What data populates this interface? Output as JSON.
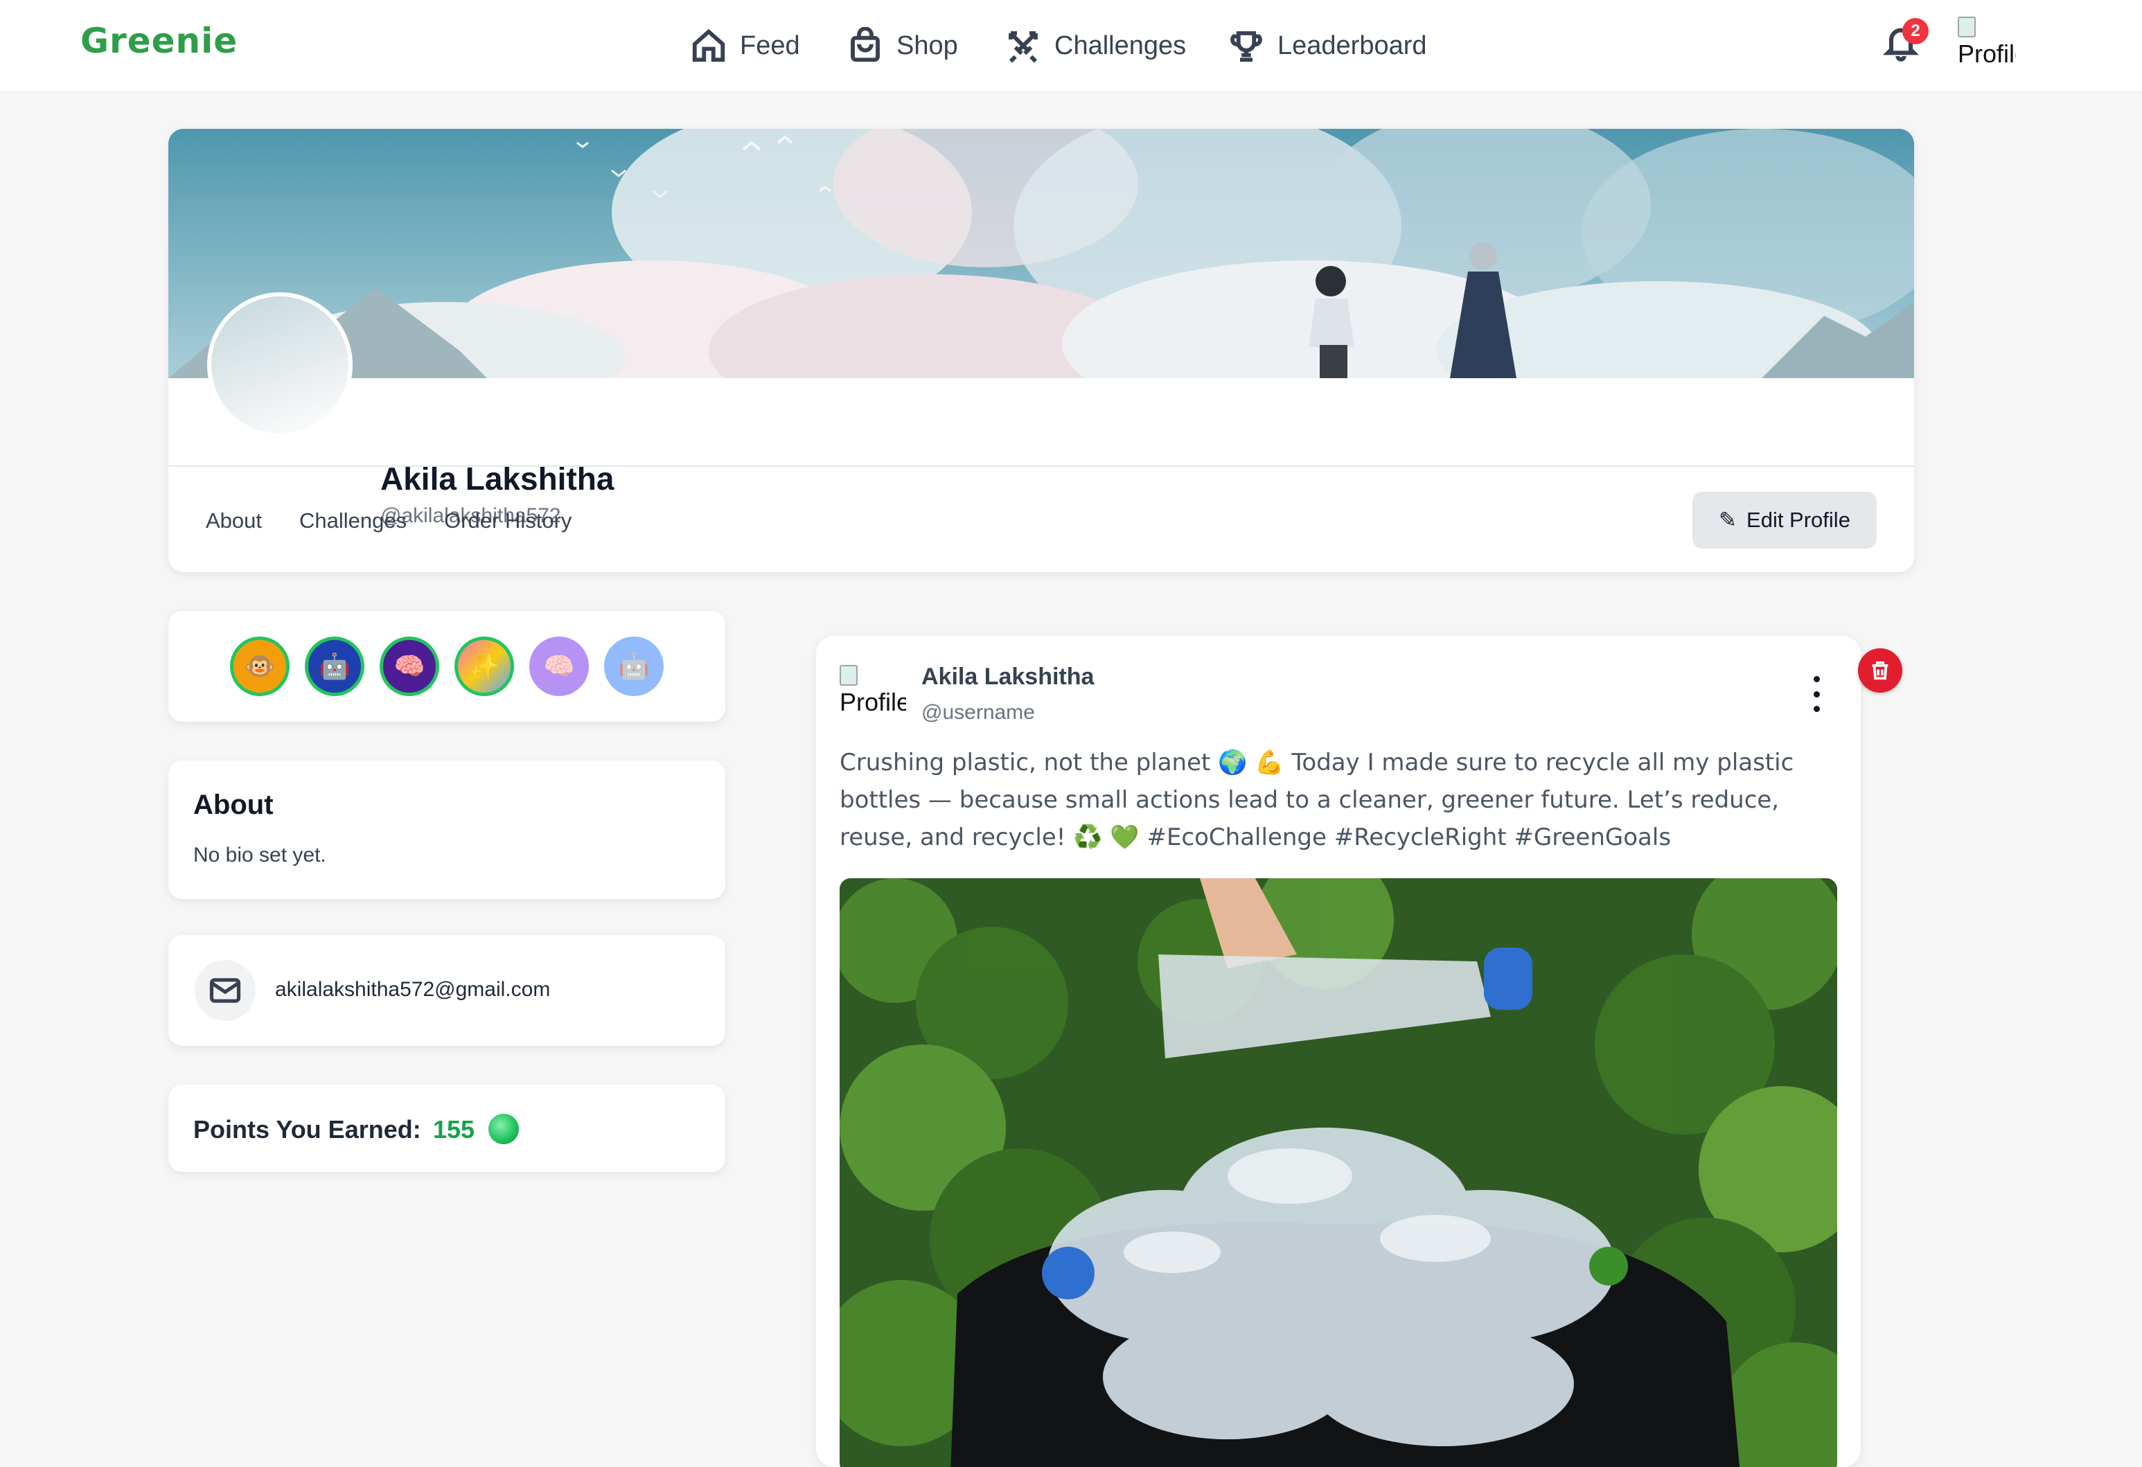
{
  "app": {
    "brand": "Greenie",
    "brand_color": "#2e9e48"
  },
  "nav": {
    "items": [
      {
        "label": "Feed",
        "icon": "home-icon"
      },
      {
        "label": "Shop",
        "icon": "shopping-bag-icon"
      },
      {
        "label": "Challenges",
        "icon": "crossed-swords-icon"
      },
      {
        "label": "Leaderboard",
        "icon": "trophy-icon"
      }
    ],
    "notifications_count": "2",
    "avatar_alt": "Profile"
  },
  "profile": {
    "name": "Akila Lakshitha",
    "handle": "@akilalakshitha572",
    "tabs": [
      "About",
      "Challenges",
      "Order History"
    ],
    "edit_label": "Edit Profile",
    "edit_icon": "✎"
  },
  "badges": [
    {
      "name": "monkey-badge",
      "emoji": "🐵",
      "earned": true,
      "bg": "#f59e0b"
    },
    {
      "name": "robot-badge",
      "emoji": "🤖",
      "earned": true,
      "bg": "#1e40af"
    },
    {
      "name": "brain-badge",
      "emoji": "🧠",
      "earned": true,
      "bg": "#4c1d95"
    },
    {
      "name": "yolo-badge",
      "emoji": "✨",
      "earned": true,
      "bg": "#ec4899"
    },
    {
      "name": "brain-badge-locked",
      "emoji": "🧠",
      "earned": false,
      "bg": "#7c3aed"
    },
    {
      "name": "robot-badge-locked",
      "emoji": "🤖",
      "earned": false,
      "bg": "#3b82f6"
    }
  ],
  "about": {
    "title": "About",
    "bio": "No bio set yet."
  },
  "contact": {
    "email": "akilalakshitha572@gmail.com"
  },
  "points": {
    "label": "Points You Earned:",
    "value": "155"
  },
  "post": {
    "author": "Akila Lakshitha",
    "username": "@username",
    "avatar_alt": "Profile",
    "text": "Crushing plastic, not the planet 🌍 💪 Today I made sure to recycle all my plastic bottles — because small actions lead to a cleaner, greener future. Let’s reduce, reuse, and recycle! ♻️ 💚 #EcoChallenge #RecycleRight #GreenGoals"
  },
  "colors": {
    "accent": "#2e9e48",
    "danger": "#e11d2e",
    "badge_ring": "#22c55e"
  }
}
